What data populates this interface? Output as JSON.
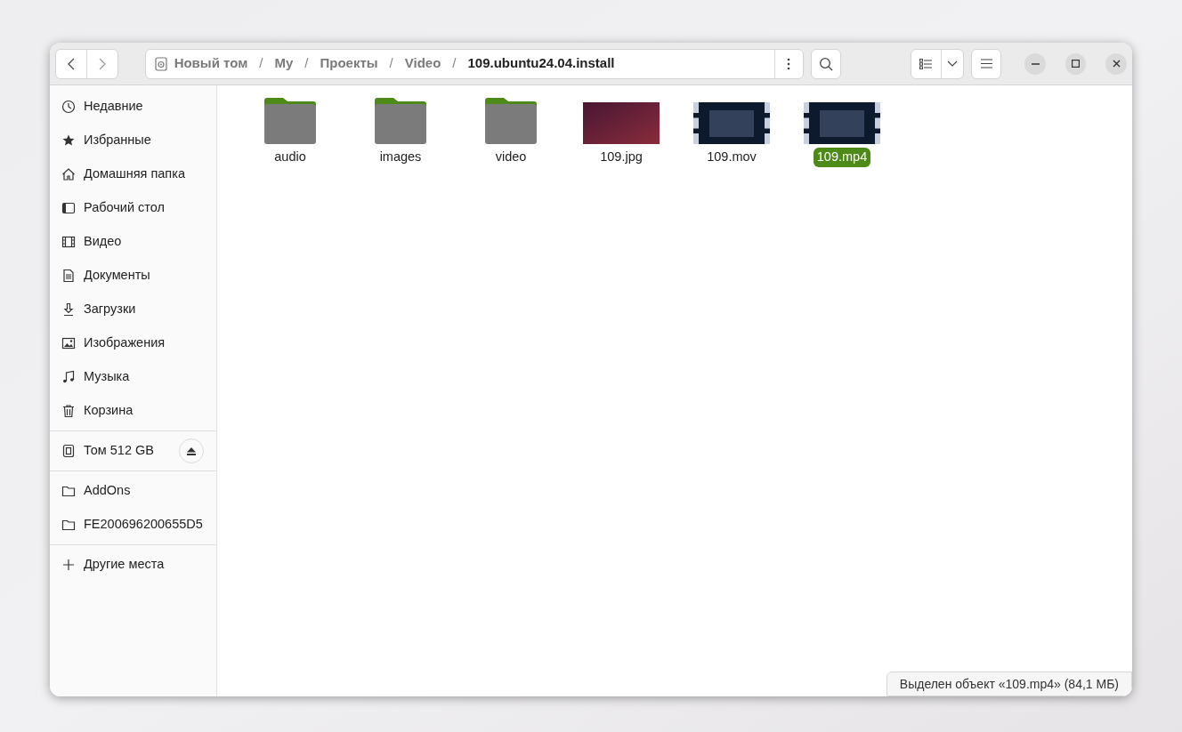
{
  "path": [
    {
      "label": "Новый том",
      "kind": "drive"
    },
    {
      "label": "My",
      "kind": "folder",
      "separator": "/"
    },
    {
      "label": "Проекты",
      "kind": "folder",
      "separator": "/"
    },
    {
      "label": "Video",
      "kind": "folder",
      "separator": "/"
    },
    {
      "label": "109.ubuntu24.04.install",
      "kind": "current",
      "separator": "/"
    }
  ],
  "sidebar": [
    {
      "items": [
        {
          "label": "Недавние",
          "kind": "recent"
        },
        {
          "label": "Избранные",
          "kind": "starred"
        },
        {
          "label": "Домашняя папка",
          "kind": "home"
        },
        {
          "label": "Рабочий стол",
          "kind": "desktop"
        },
        {
          "label": "Видео",
          "kind": "videos"
        },
        {
          "label": "Документы",
          "kind": "documents"
        },
        {
          "label": "Загрузки",
          "kind": "downloads"
        },
        {
          "label": "Изображения",
          "kind": "pictures"
        },
        {
          "label": "Музыка",
          "kind": "music"
        },
        {
          "label": "Корзина",
          "kind": "trash"
        }
      ]
    },
    {
      "items": [
        {
          "label": "Том 512 GB",
          "kind": "drive",
          "eject": true
        }
      ]
    },
    {
      "items": [
        {
          "label": "AddOns",
          "kind": "bookmark"
        },
        {
          "label": "FE200696200655D5",
          "kind": "bookmark"
        }
      ]
    },
    {
      "items": [
        {
          "label": "Другие места",
          "kind": "other"
        }
      ]
    }
  ],
  "files": [
    {
      "name": "audio",
      "kind": "folder",
      "selected": false
    },
    {
      "name": "images",
      "kind": "folder",
      "selected": false
    },
    {
      "name": "video",
      "kind": "folder",
      "selected": false
    },
    {
      "name": "109.jpg",
      "kind": "image",
      "selected": false
    },
    {
      "name": "109.mov",
      "kind": "video",
      "selected": false
    },
    {
      "name": "109.mp4",
      "kind": "video",
      "selected": true
    }
  ],
  "status_bar": "Выделен объект «109.mp4» (84,1 МБ)"
}
